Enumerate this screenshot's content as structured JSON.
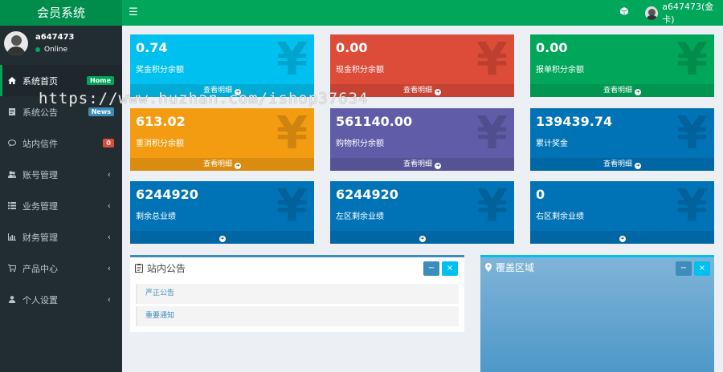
{
  "header": {
    "app_title": "会员系统",
    "menu_icon": "☰",
    "user_label": "a647473(金卡)"
  },
  "sidebar": {
    "user": {
      "name": "a647473",
      "status": "Online"
    },
    "items": [
      {
        "label": "系统首页",
        "icon": "home-icon",
        "badge": "Home",
        "badge_color": "#00a65a"
      },
      {
        "label": "系统公告",
        "icon": "note-icon",
        "badge": "News",
        "badge_color": "#3c8dbc"
      },
      {
        "label": "站内信件",
        "icon": "comment-icon",
        "badge": "0",
        "badge_color": "#dd4b39"
      },
      {
        "label": "账号管理",
        "icon": "users-icon",
        "chevron": "‹"
      },
      {
        "label": "业务管理",
        "icon": "list-icon",
        "chevron": "‹"
      },
      {
        "label": "财务管理",
        "icon": "bar-chart-icon",
        "chevron": "‹"
      },
      {
        "label": "产品中心",
        "icon": "cart-icon",
        "chevron": "‹"
      },
      {
        "label": "个人设置",
        "icon": "user-icon",
        "chevron": "‹"
      }
    ]
  },
  "stats": [
    {
      "value": "0.74",
      "label": "奖金积分余额",
      "footer": "查看明细",
      "color": "#00c0ef"
    },
    {
      "value": "0.00",
      "label": "现金积分余额",
      "footer": "查看明细",
      "color": "#dd4b39"
    },
    {
      "value": "0.00",
      "label": "报单积分余额",
      "footer": "查看明细",
      "color": "#00a65a"
    },
    {
      "value": "613.02",
      "label": "重消积分余额",
      "footer": "查看明细",
      "color": "#f39c12"
    },
    {
      "value": "561140.00",
      "label": "购物积分余额",
      "footer": "查看明细",
      "color": "#605ca8"
    },
    {
      "value": "139439.74",
      "label": "累计奖金",
      "footer": "查看明细",
      "color": "#0073b7"
    },
    {
      "value": "6244920",
      "label": "剩余总业绩",
      "footer": "",
      "color": "#0073b7"
    },
    {
      "value": "6244920",
      "label": "左区剩余业绩",
      "footer": "",
      "color": "#0073b7"
    },
    {
      "value": "0",
      "label": "右区剩余业绩",
      "footer": "",
      "color": "#0073b7"
    }
  ],
  "yen_symbol": "¥",
  "announcements": {
    "title": "站内公告",
    "items": [
      "严正公告",
      "重要通知"
    ],
    "minimize": "−",
    "close": "×"
  },
  "coverage": {
    "title": "覆盖区域",
    "minimize": "−",
    "close": "×"
  },
  "watermark": "https://www.huzhan.com/ishop37634"
}
